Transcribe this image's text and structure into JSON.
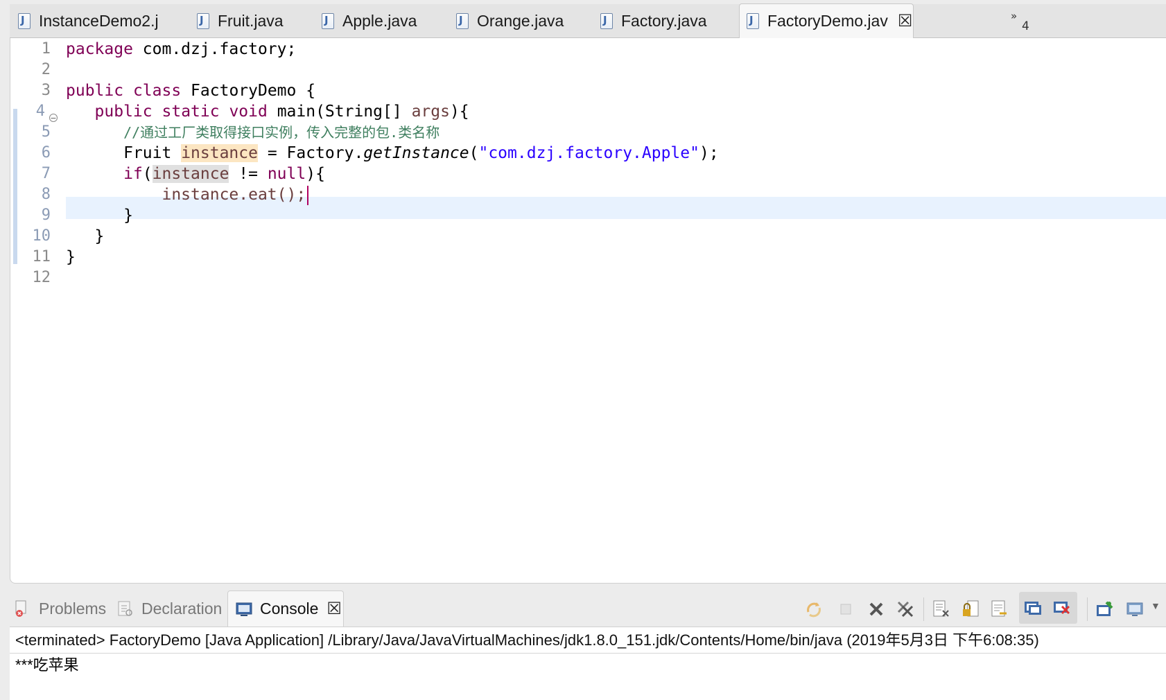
{
  "editor_tabs": [
    {
      "label": "InstanceDemo2.j",
      "icon": "java-file-icon",
      "active": false
    },
    {
      "label": "Fruit.java",
      "icon": "java-file-icon",
      "active": false
    },
    {
      "label": "Apple.java",
      "icon": "java-file-icon",
      "active": false
    },
    {
      "label": "Orange.java",
      "icon": "java-file-icon",
      "active": false
    },
    {
      "label": "Factory.java",
      "icon": "java-file-icon",
      "active": false
    },
    {
      "label": "FactoryDemo.jav",
      "icon": "java-file-icon",
      "active": true
    }
  ],
  "tab_close_glyph": "☒",
  "overflow": {
    "glyph": "»",
    "count": "4"
  },
  "line_numbers": [
    "1",
    "2",
    "3",
    "4",
    "5",
    "6",
    "7",
    "8",
    "9",
    "10",
    "11",
    "12"
  ],
  "code": {
    "l1": {
      "kw": "package",
      "rest": " com.dzj.factory;"
    },
    "l3": {
      "kw1": "public",
      "kw2": "class",
      "rest": " FactoryDemo {"
    },
    "l4": {
      "indent": "   ",
      "kw1": "public",
      "kw2": "static",
      "kw3": "void",
      "rest": " main(String[] ",
      "param": "args",
      "end": "){"
    },
    "l5": {
      "indent": "      ",
      "comment": "//通过工厂类取得接口实例，传入完整的包.类名称"
    },
    "l6": {
      "indent": "      ",
      "type": "Fruit ",
      "var": "instance",
      "mid": " = Factory.",
      "method": "getInstance",
      "open": "(",
      "str": "\"com.dzj.factory.Apple\"",
      "end": ");"
    },
    "l7": {
      "indent": "      ",
      "kw": "if",
      "open": "(",
      "var": "instance",
      "mid": " != ",
      "kw2": "null",
      "end": "){"
    },
    "l8": {
      "indent": "          ",
      "text": "instance.eat();"
    },
    "l9": {
      "indent": "      ",
      "text": "}"
    },
    "l10": {
      "indent": "   ",
      "text": "}"
    },
    "l11": {
      "text": "}"
    }
  },
  "bottom_tabs": [
    {
      "label": "Problems",
      "icon": "problems-icon",
      "active": false
    },
    {
      "label": "Declaration",
      "icon": "declaration-icon",
      "active": false
    },
    {
      "label": "Console",
      "icon": "console-icon",
      "active": true
    }
  ],
  "console": {
    "status": "<terminated> FactoryDemo [Java Application] /Library/Java/JavaVirtualMachines/jdk1.8.0_151.jdk/Contents/Home/bin/java (2019年5月3日 下午6:08:35)",
    "output": "***吃苹果"
  },
  "toolbar_icons": [
    "relaunch-icon",
    "terminate-icon",
    "remove-launch-icon",
    "remove-all-terminated-icon",
    "clear-console-icon",
    "scroll-lock-icon",
    "word-wrap-icon",
    "show-on-stdout-icon",
    "show-on-stderr-icon",
    "pin-console-icon",
    "display-console-icon"
  ]
}
